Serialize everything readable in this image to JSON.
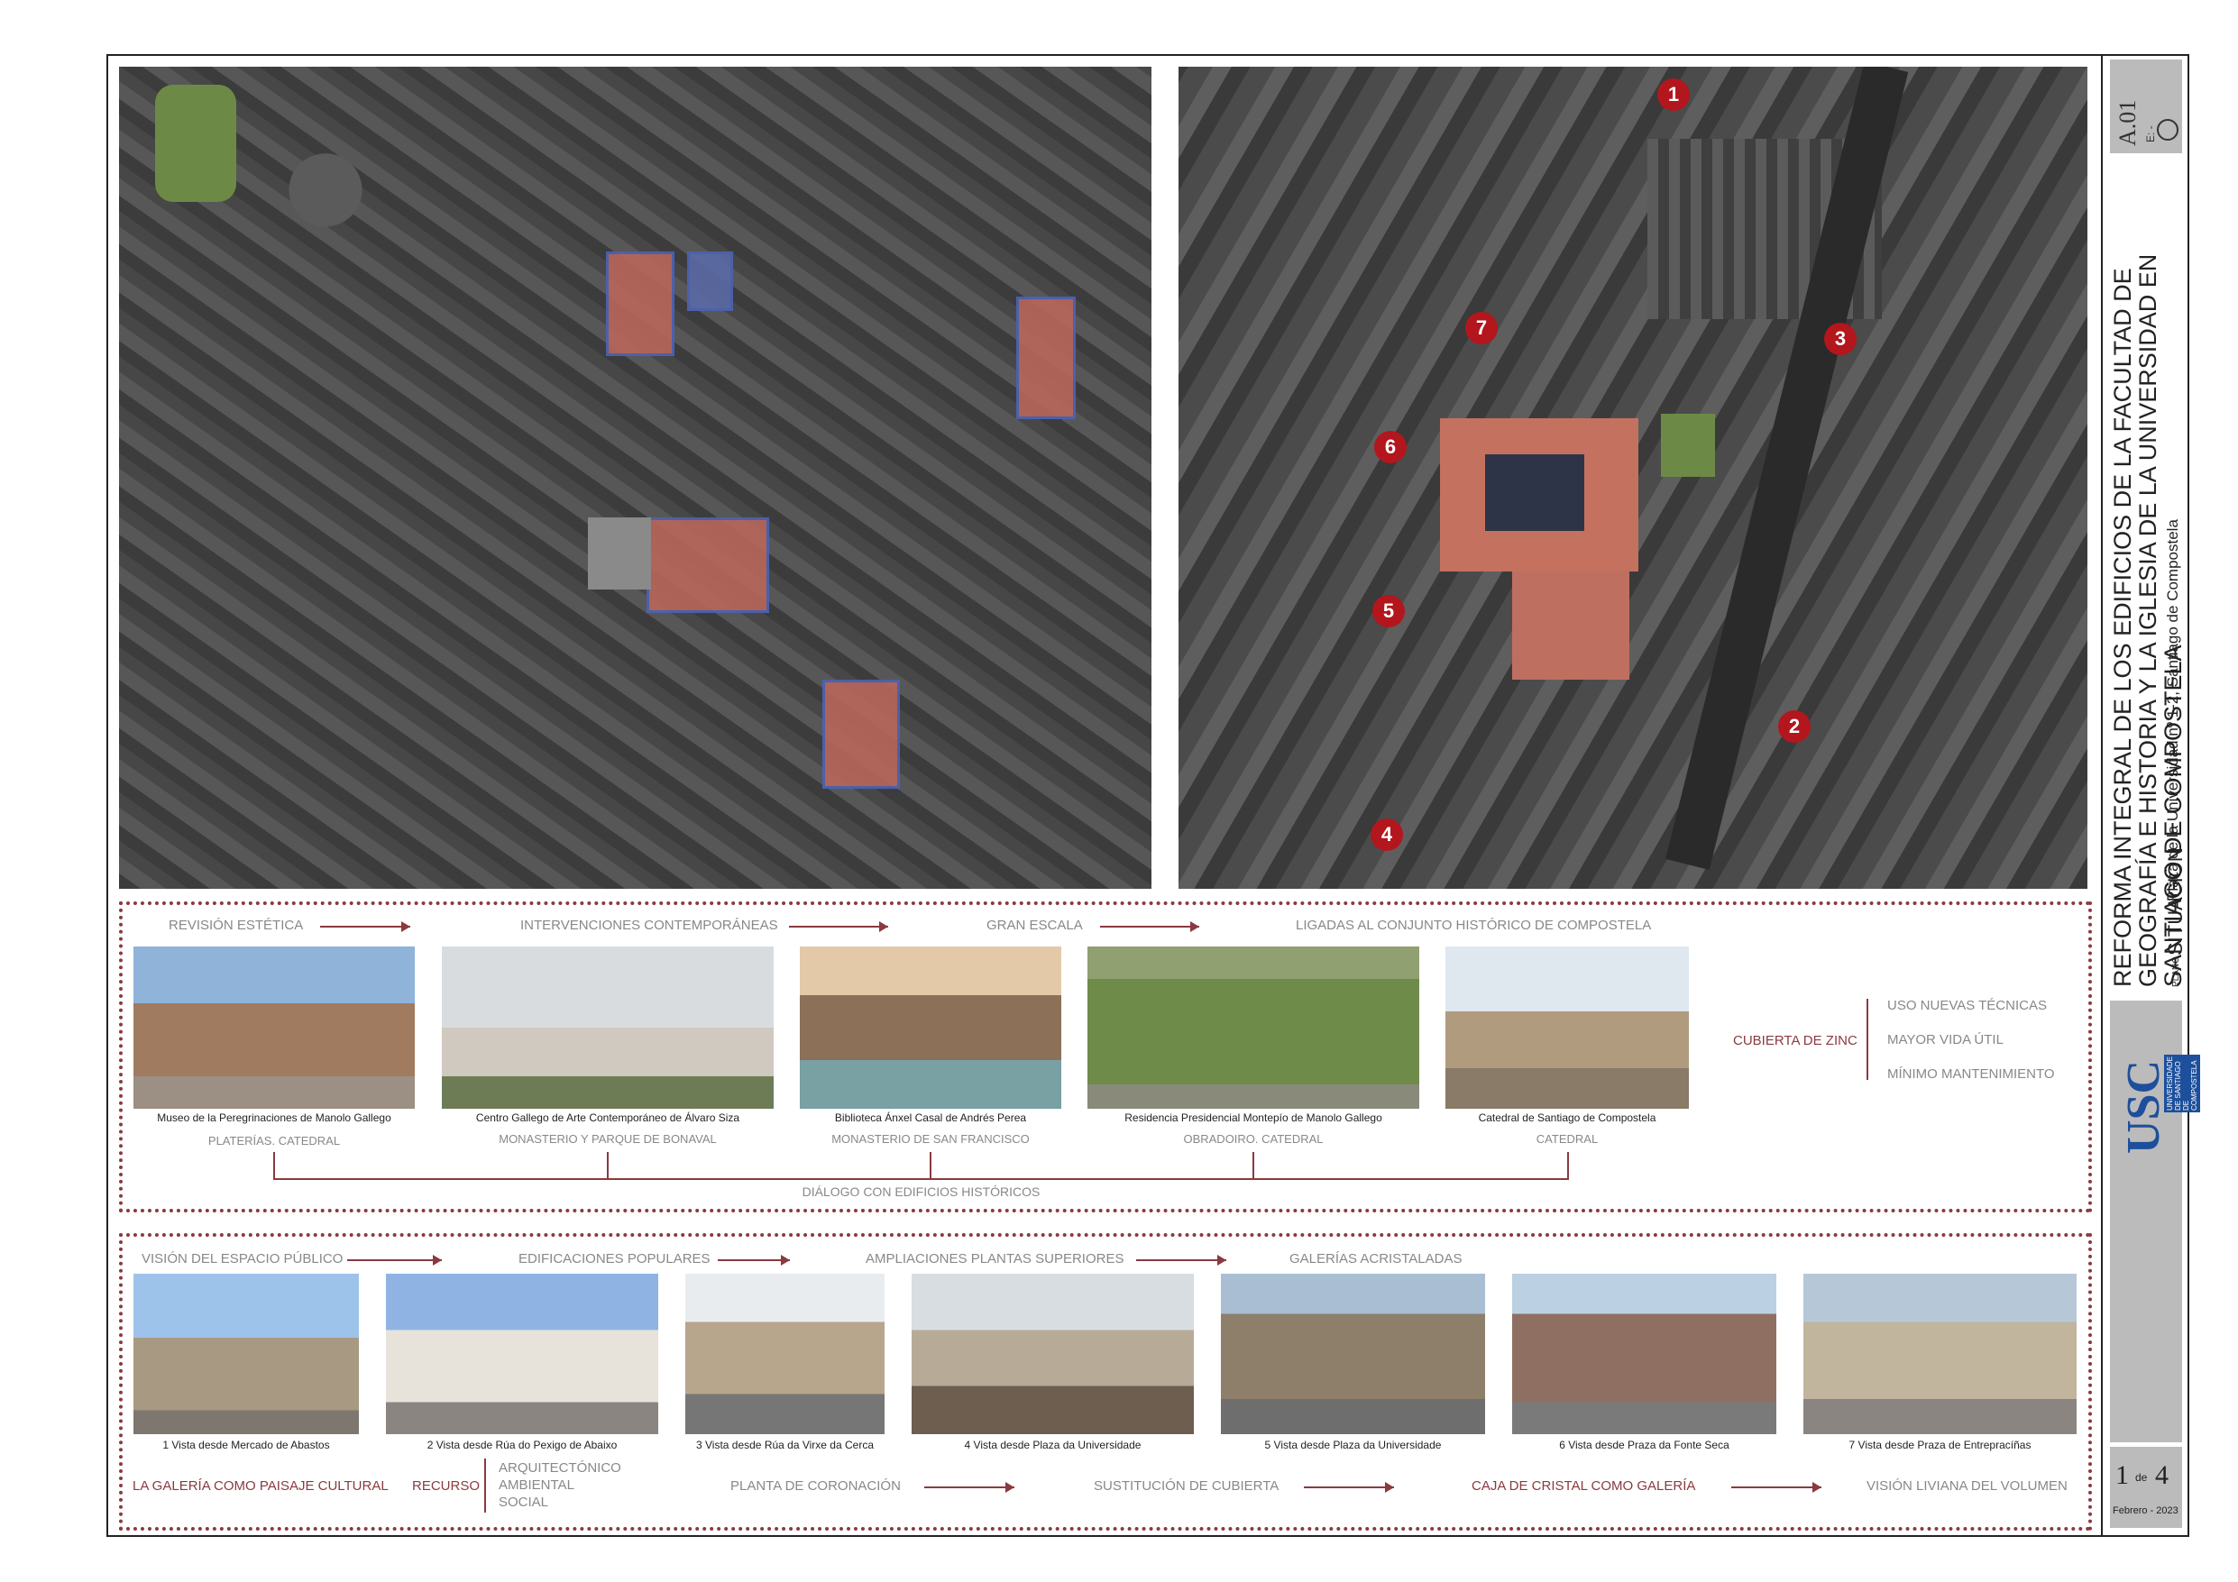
{
  "map_right_markers": [
    "1",
    "2",
    "3",
    "4",
    "5",
    "6",
    "7"
  ],
  "section1": {
    "flow": [
      "REVISIÓN ESTÉTICA",
      "INTERVENCIONES CONTEMPORÁNEAS",
      "GRAN ESCALA",
      "LIGADAS AL CONJUNTO HISTÓRICO DE COMPOSTELA"
    ],
    "photos": [
      {
        "caption": "Museo de la Peregrinaciones de Manolo Gallego",
        "sub": "PLATERÍAS. CATEDRAL"
      },
      {
        "caption": "Centro Gallego de Arte Contemporáneo de Álvaro Siza",
        "sub": "MONASTERIO Y PARQUE DE BONAVAL"
      },
      {
        "caption": "Biblioteca Ánxel Casal de Andrés Perea",
        "sub": "MONASTERIO DE SAN FRANCISCO"
      },
      {
        "caption": "Residencia Presidencial Montepío de Manolo Gallego",
        "sub": "OBRADOIRO. CATEDRAL"
      },
      {
        "caption": "Catedral de Santiago de Compostela",
        "sub": "CATEDRAL"
      }
    ],
    "dialog": "DIÁLOGO CON EDIFICIOS HISTÓRICOS",
    "zinc": "CUBIERTA DE ZINC",
    "zinc_items": [
      "USO NUEVAS TÉCNICAS",
      "MAYOR VIDA ÚTIL",
      "MÍNIMO MANTENIMIENTO"
    ]
  },
  "section2": {
    "flow": [
      "VISIÓN DEL ESPACIO PÚBLICO",
      "EDIFICACIONES POPULARES",
      "AMPLIACIONES PLANTAS SUPERIORES",
      "GALERÍAS ACRISTALADAS"
    ],
    "photos": [
      "1 Vista desde Mercado de Abastos",
      "2 Vista desde Rúa do Pexigo de Abaixo",
      "3 Vista desde Rúa da Virxe da Cerca",
      "4 Vista desde Plaza da Universidade",
      "5 Vista desde Plaza da Universidade",
      "6 Vista desde Praza da Fonte Seca",
      "7 Vista desde Praza de Entrepracíñas"
    ],
    "bottom": {
      "galeria": "LA GALERÍA COMO PAISAJE CULTURAL",
      "recurso": "RECURSO",
      "recurso_items": [
        "ARQUITECTÓNICO",
        "AMBIENTAL",
        "SOCIAL"
      ],
      "planta": "PLANTA DE CORONACIÓN",
      "sustitucion": "SUSTITUCIÓN DE CUBIERTA",
      "caja": "CAJA DE CRISTAL COMO GALERÍA",
      "vision": "VISIÓN  LIVIANA DEL VOLUMEN"
    }
  },
  "sidebar": {
    "code": "A.01",
    "scale": "E: -",
    "title": "REFORMA INTEGRAL DE LOS EDIFICIOS DE LA FACULTAD DE GEOGRAFÍA E HISTORIA Y LA IGLESIA DE LA UNIVERSIDAD EN SANTIAGO DE COMPOSTELA",
    "address": "Plaza de la Universidad nº 1-2, Santiago de Compostela",
    "plano_label": "PLANO",
    "plano": "SITUACIÓN",
    "logo": "USC",
    "logo_text": "UNIVERSIDADE DE SANTIAGO DE COMPOSTELA",
    "page": "1",
    "page_of": "de",
    "page_total": "4",
    "date": "Febrero - 2023"
  }
}
